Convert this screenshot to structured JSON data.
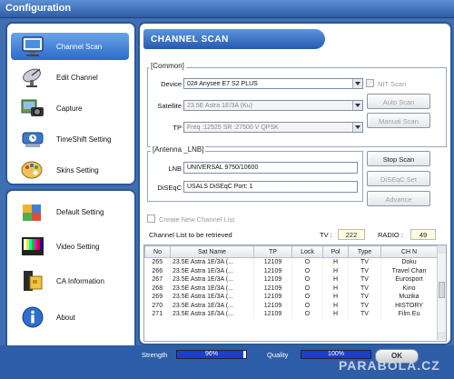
{
  "window": {
    "title": "Configuration"
  },
  "sidebar": {
    "items_top": [
      {
        "label": "Channel Scan",
        "icon": "monitor-icon",
        "active": true
      },
      {
        "label": "Edit Channel",
        "icon": "satellite-dish-icon"
      },
      {
        "label": "Capture",
        "icon": "camera-icon"
      },
      {
        "label": "TimeShift Setting",
        "icon": "timeshift-icon"
      },
      {
        "label": "Skins Setting",
        "icon": "palette-icon"
      }
    ],
    "items_bottom": [
      {
        "label": "Default Setting",
        "icon": "puzzle-icon"
      },
      {
        "label": "Video Setting",
        "icon": "color-bars-icon"
      },
      {
        "label": "CA Information",
        "icon": "card-icon"
      },
      {
        "label": "About",
        "icon": "info-icon"
      }
    ]
  },
  "header": {
    "title": "CHANNEL SCAN"
  },
  "common": {
    "title": "[Common]",
    "device_label": "Device",
    "device_value": "02# Anysee E7 S2 PLUS",
    "nit_label": "NIT Scan",
    "satellite_label": "Satellite",
    "satellite_value": "23.5E Astra 1E/3A (Ku)",
    "tp_label": "TP",
    "tp_value": "Freq :12525   SR :27500   V   QPSK",
    "auto_scan": "Auto Scan",
    "manual_scan": "Manual Scan"
  },
  "antenna": {
    "title": "[Antenna _LNB]",
    "lnb_label": "LNB",
    "lnb_value": "UNIVERSAL    9750/10600",
    "diseqc_label": "DiSEqC",
    "diseqc_value": "USALS    DiSEqC Port: 1",
    "stop_scan": "Stop Scan",
    "diseqc_set": "DiSEqC Set",
    "advance": "Advance"
  },
  "options": {
    "create_new_list": "Create New Channel List"
  },
  "list": {
    "caption": "Channel List to be retrieved",
    "tv_label": "TV :",
    "tv_count": "222",
    "radio_label": "RADIO :",
    "radio_count": "49",
    "columns": [
      "No",
      "Sat Name",
      "TP",
      "Lock",
      "Pol",
      "Type",
      "CH N"
    ],
    "rows": [
      [
        "265",
        "23.5E Astra 1E/3A (...",
        "12109",
        "O",
        "H",
        "TV",
        "Doku"
      ],
      [
        "266",
        "23.5E Astra 1E/3A (...",
        "12109",
        "O",
        "H",
        "TV",
        "Travel Chan"
      ],
      [
        "267",
        "23.5E Astra 1E/3A (...",
        "12109",
        "O",
        "H",
        "TV",
        "Eurosport"
      ],
      [
        "268",
        "23.5E Astra 1E/3A (...",
        "12109",
        "O",
        "H",
        "TV",
        "Kino"
      ],
      [
        "269",
        "23.5E Astra 1E/3A (...",
        "12109",
        "O",
        "H",
        "TV",
        "Muzika"
      ],
      [
        "270",
        "23.5E Astra 1E/3A (...",
        "12109",
        "O",
        "H",
        "TV",
        "HISTORY"
      ],
      [
        "271",
        "23.5E Astra 1E/3A (...",
        "12109",
        "O",
        "H",
        "TV",
        "Film Eu"
      ]
    ]
  },
  "status": {
    "strength_label": "Strength",
    "strength_value": "96%",
    "strength_fraction": 0.96,
    "quality_label": "Quality",
    "quality_value": "100%",
    "quality_fraction": 1.0,
    "ok_label": "OK"
  },
  "watermark": "PARABOLA.CZ",
  "colors": {
    "accent": "#2f5ea8",
    "meter_fill": "#1f3dcc"
  }
}
